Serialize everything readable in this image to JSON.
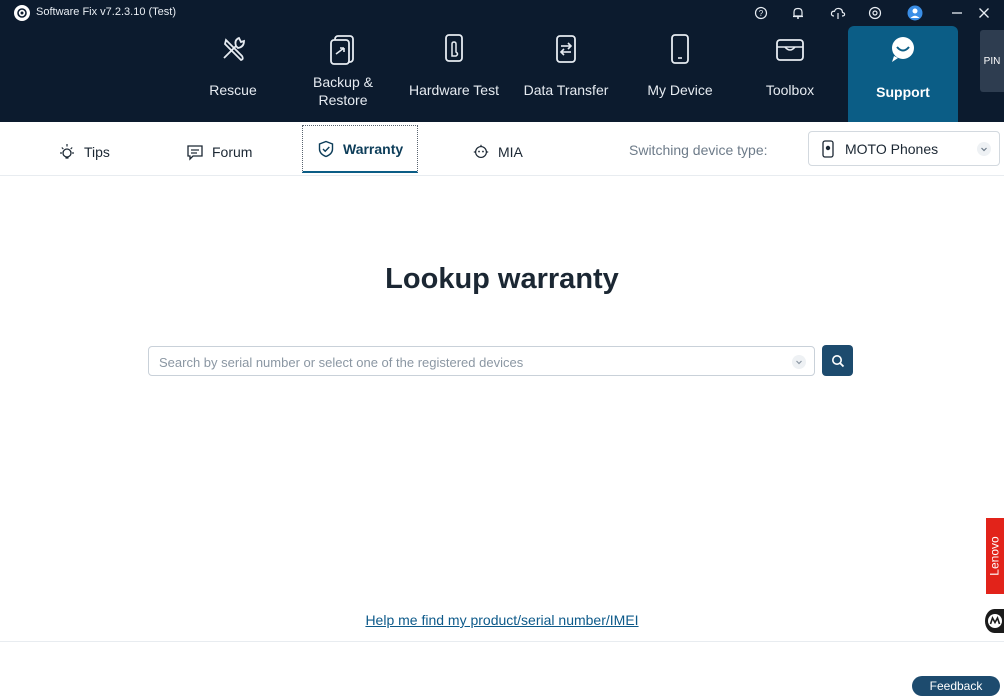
{
  "titlebar": {
    "app_title": "Software Fix v7.2.3.10 (Test)",
    "icons": [
      "help-icon",
      "bell-icon",
      "cloud-icon",
      "settings-icon",
      "user-icon",
      "minimize-icon",
      "close-icon"
    ]
  },
  "nav": {
    "items": [
      {
        "label": "Rescue",
        "icon": "tools-icon"
      },
      {
        "label": "Backup &",
        "label2": "Restore",
        "icon": "backup-icon"
      },
      {
        "label": "Hardware Test",
        "icon": "hardware-icon"
      },
      {
        "label": "Data Transfer",
        "icon": "transfer-icon"
      },
      {
        "label": "My Device",
        "icon": "phone-icon"
      },
      {
        "label": "Toolbox",
        "icon": "toolbox-icon"
      },
      {
        "label": "Support",
        "icon": "chat-icon"
      }
    ],
    "active": "Support",
    "pin_label": "PIN"
  },
  "subtabs": {
    "items": [
      {
        "label": "Tips",
        "icon": "bulb-icon"
      },
      {
        "label": "Forum",
        "icon": "forum-icon"
      },
      {
        "label": "Warranty",
        "icon": "shield-icon"
      },
      {
        "label": "MIA",
        "icon": "mia-icon"
      }
    ],
    "active": "Warranty",
    "switch_label": "Switching device type:",
    "device_type": "MOTO Phones"
  },
  "main": {
    "heading": "Lookup warranty",
    "search_placeholder": "Search by serial number or select one of the registered devices",
    "help_link": "Help me find my product/serial number/IMEI"
  },
  "side": {
    "lenovo": "Lenovo"
  },
  "footer": {
    "feedback": "Feedback"
  },
  "colors": {
    "nav_bg": "#0c1b2e",
    "active_tab": "#0b5d86",
    "button": "#1d4b6e",
    "lenovo_red": "#e2231a"
  }
}
